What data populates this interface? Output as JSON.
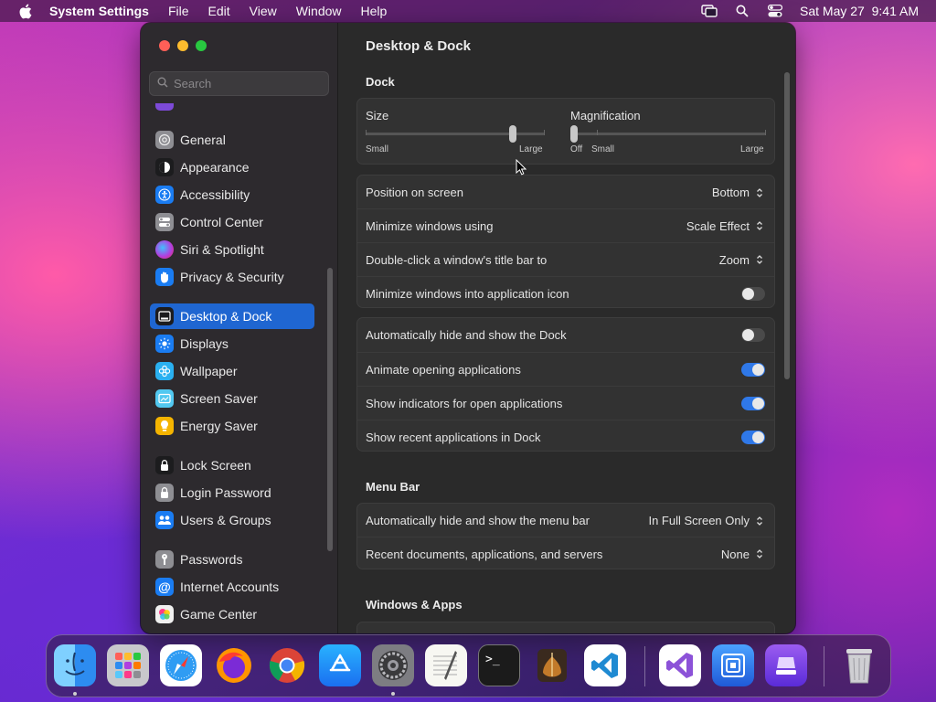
{
  "menubar": {
    "app_name": "System Settings",
    "menus": [
      "File",
      "Edit",
      "View",
      "Window",
      "Help"
    ],
    "clock": "Sat May 27  9:41 AM",
    "icons": [
      "apple-icon",
      "screen-mirroring-icon",
      "spotlight-icon",
      "control-center-icon"
    ]
  },
  "sidebar": {
    "search_placeholder": "Search",
    "items": [
      {
        "label": "General",
        "icon": "gear-icon",
        "color": "#8e8e93"
      },
      {
        "label": "Appearance",
        "icon": "appearance-icon",
        "color": "#1c1c1e"
      },
      {
        "label": "Accessibility",
        "icon": "accessibility-icon",
        "color": "#1a7cf2"
      },
      {
        "label": "Control Center",
        "icon": "control-center-icon",
        "color": "#8e8e93"
      },
      {
        "label": "Siri & Spotlight",
        "icon": "siri-icon",
        "color": "#b040e0"
      },
      {
        "label": "Privacy & Security",
        "icon": "hand-icon",
        "color": "#1a7cf2"
      },
      {
        "label": "Desktop & Dock",
        "icon": "dock-icon",
        "color": "#1c1c1e"
      },
      {
        "label": "Displays",
        "icon": "sun-icon",
        "color": "#1a7cf2"
      },
      {
        "label": "Wallpaper",
        "icon": "flower-icon",
        "color": "#2ab0f0"
      },
      {
        "label": "Screen Saver",
        "icon": "screen-saver-icon",
        "color": "#52c8f0"
      },
      {
        "label": "Energy Saver",
        "icon": "bulb-icon",
        "color": "#f5b400"
      },
      {
        "label": "Lock Screen",
        "icon": "lock-icon",
        "color": "#1c1c1e"
      },
      {
        "label": "Login Password",
        "icon": "padlock-icon",
        "color": "#8e8e93"
      },
      {
        "label": "Users & Groups",
        "icon": "users-icon",
        "color": "#1a7cf2"
      },
      {
        "label": "Passwords",
        "icon": "key-icon",
        "color": "#8e8e93"
      },
      {
        "label": "Internet Accounts",
        "icon": "at-icon",
        "color": "#1a7cf2"
      },
      {
        "label": "Game Center",
        "icon": "game-center-icon",
        "color": "#f0f0f0"
      }
    ],
    "selected": "Desktop & Dock"
  },
  "content": {
    "title": "Desktop & Dock",
    "dock_section": "Dock",
    "size_slider": {
      "label": "Size",
      "min_label": "Small",
      "max_label": "Large",
      "value": 0.85
    },
    "magnification_slider": {
      "label": "Magnification",
      "off_label": "Off",
      "min_label": "Small",
      "max_label": "Large",
      "value": 0.0
    },
    "position_rows": [
      {
        "label": "Position on screen",
        "value": "Bottom"
      },
      {
        "label": "Minimize windows using",
        "value": "Scale Effect"
      },
      {
        "label": "Double-click a window's title bar to",
        "value": "Zoom"
      },
      {
        "label": "Minimize windows into application icon",
        "toggle": false
      }
    ],
    "dock_toggles": [
      {
        "label": "Automatically hide and show the Dock",
        "toggle": false
      },
      {
        "label": "Animate opening applications",
        "toggle": true
      },
      {
        "label": "Show indicators for open applications",
        "toggle": true
      },
      {
        "label": "Show recent applications in Dock",
        "toggle": true
      }
    ],
    "menu_bar_section": "Menu Bar",
    "menu_bar_rows": [
      {
        "label": "Automatically hide and show the menu bar",
        "value": "In Full Screen Only"
      },
      {
        "label": "Recent documents, applications, and servers",
        "value": "None"
      }
    ],
    "windows_apps_section": "Windows & Apps"
  },
  "dock": {
    "apps": [
      "Finder",
      "Launchpad",
      "Safari",
      "Firefox",
      "Chrome",
      "App Store",
      "System Settings",
      "TextEdit",
      "Terminal",
      "Instruments",
      "Visual Studio Code",
      "Visual Studio",
      "Simulator",
      "Pastel"
    ],
    "trash": "Trash"
  }
}
